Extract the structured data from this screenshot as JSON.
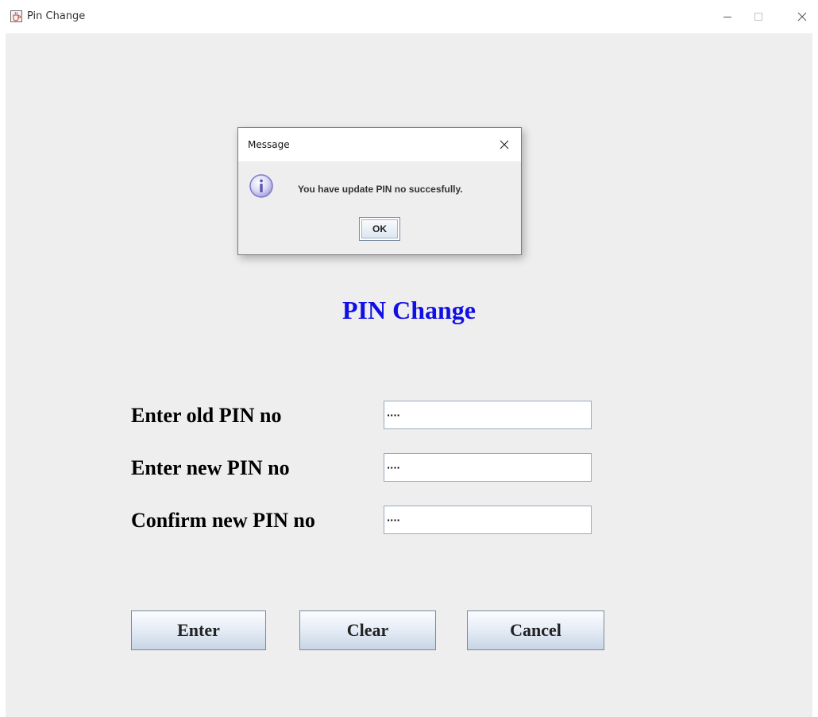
{
  "window": {
    "title": "Pin Change",
    "icon": "java-cup-icon",
    "controls": [
      "minimize-icon",
      "maximize-icon",
      "close-icon"
    ]
  },
  "form": {
    "heading": "PIN Change",
    "heading_color": "#0f0fe6",
    "fields": [
      {
        "label": "Enter old PIN no",
        "value": "····"
      },
      {
        "label": "Enter new PIN no",
        "value": "····"
      },
      {
        "label": "Confirm new PIN no",
        "value": "····"
      }
    ],
    "buttons": {
      "enter": "Enter",
      "clear": "Clear",
      "cancel": "Cancel"
    }
  },
  "dialog": {
    "title": "Message",
    "icon": "info-icon",
    "message": "You have update PIN no succesfully.",
    "ok_label": "OK"
  }
}
